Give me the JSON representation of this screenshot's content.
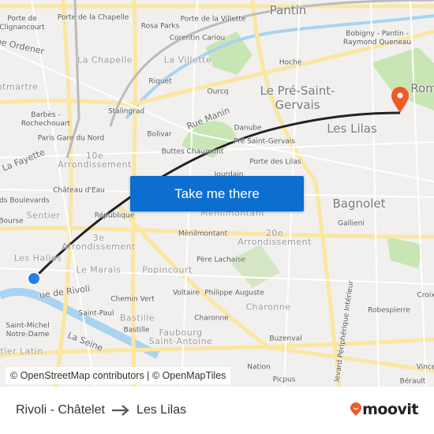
{
  "map": {
    "labels": [
      "Porte de\nClignancourt",
      "Porte de la Chapelle",
      "Rosa Parks",
      "Porte de la Villette",
      "Corentin Cariou",
      "Pantin",
      "Bobigny - Pantin -\nRaymond Queneau",
      "Rue Ordener",
      "La Chapelle",
      "La Villette",
      "Hoche",
      "ntmartre",
      "Riquet",
      "Ourcq",
      "Le Pré-Saint-\nGervais",
      "Rom",
      "Barbès -\nRochechouart",
      "Stalingrad",
      "Rue Manin",
      "Danube",
      "Les Lilas",
      "Bolivar",
      "Paris Gare du Nord",
      "Pré Saint-Gervais",
      "Buttes Chaumont",
      "e La Fayette",
      "10e\nArrondissement",
      "Porte des Lilas",
      "Jourdain",
      "Château d'Eau",
      "nds Boulevards",
      "Sentier",
      "République",
      "Ménilmontant",
      "Bagnolet",
      "Bourse",
      "3e\nArrondissement",
      "Ménilmontant",
      "20e\nArrondissement",
      "Gallieni",
      "Les Halles",
      "Père Lachaise",
      "Le Marais",
      "Popincourt",
      "ue de Rivoli",
      "Chemin Vert",
      "Voltaire",
      "Philippe Auguste",
      "Charonne",
      "levard Périphérique Intérieur",
      "Croix",
      "Robespierre",
      "Saint-Paul",
      "Bastille",
      "Bastille",
      "Charonne",
      "Saint-Michel\nNotre-Dame",
      "Faubourg\nSaint-Antoine",
      "Buzenval",
      "La Seine",
      "rtier Latin",
      "Nation",
      "Vince",
      "Bérault",
      "Picpus"
    ],
    "origin_marker": "blue-dot-icon",
    "destination_marker": "orange-pin-icon",
    "route_color": "#222222",
    "destination_color": "#f05a28"
  },
  "cta": {
    "label": "Take me there",
    "color": "#0c6fd0"
  },
  "attribution": "© OpenStreetMap contributors | © OpenMapTiles",
  "footer": {
    "origin": "Rivoli - Châtelet",
    "arrow": "arrow-right-icon",
    "destination": "Les Lilas",
    "brand": "moovit"
  }
}
